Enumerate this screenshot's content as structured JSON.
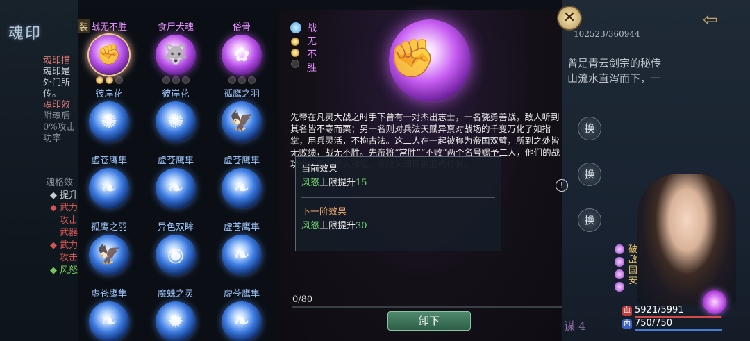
{
  "left_panel": {
    "title": "魂印",
    "lines": [
      {
        "text": "魂印描",
        "style": "head"
      },
      {
        "text": "魂印是",
        "style": "normal"
      },
      {
        "text": "外门所",
        "style": "normal"
      },
      {
        "text": "传。",
        "style": "normal"
      },
      {
        "text": "魂印效",
        "style": "head"
      },
      {
        "text": "附魂后",
        "style": "mute"
      },
      {
        "text": "0%攻击",
        "style": "mute"
      },
      {
        "text": "功率",
        "style": "mute"
      }
    ],
    "lines2": [
      {
        "text": "魂格效",
        "style": "mute"
      },
      {
        "text": "◆ 提升",
        "style": "normal"
      },
      {
        "text": "◆ 武力",
        "style": "red"
      },
      {
        "text": "攻击",
        "style": "red"
      },
      {
        "text": "武器",
        "style": "red"
      },
      {
        "text": "◆ 武力",
        "style": "red"
      },
      {
        "text": "攻击",
        "style": "red"
      },
      {
        "text": "◆ 风怒",
        "style": "green"
      }
    ]
  },
  "grid": {
    "equipped_tag": "装",
    "cells": [
      {
        "name": "战无不胜",
        "color": "purple",
        "glyph": "✊",
        "dots": [
          1,
          1,
          0
        ],
        "selected": true
      },
      {
        "name": "食尸犬魂",
        "color": "purple",
        "glyph": "🐺",
        "dots": [
          0,
          0,
          0
        ],
        "selected": false
      },
      {
        "name": "俗骨",
        "color": "purple",
        "glyph": "✿",
        "dots": [
          0,
          0,
          0
        ],
        "selected": false
      },
      {
        "name": "彼岸花",
        "color": "blue",
        "glyph": "✺",
        "dots": [],
        "selected": false
      },
      {
        "name": "彼岸花",
        "color": "blue",
        "glyph": "✺",
        "dots": [],
        "selected": false
      },
      {
        "name": "孤鹰之羽",
        "color": "blue",
        "glyph": "🦅",
        "dots": [],
        "selected": false
      },
      {
        "name": "虚苍鹰隼",
        "color": "blue",
        "glyph": "❧",
        "dots": [],
        "selected": false
      },
      {
        "name": "虚苍鹰隼",
        "color": "blue",
        "glyph": "❧",
        "dots": [],
        "selected": false
      },
      {
        "name": "虚苍鹰隼",
        "color": "blue",
        "glyph": "❧",
        "dots": [],
        "selected": false
      },
      {
        "name": "孤鹰之羽",
        "color": "blue",
        "glyph": "🦅",
        "dots": [],
        "selected": false
      },
      {
        "name": "异色双眸",
        "color": "blue",
        "glyph": "◉",
        "dots": [],
        "selected": false
      },
      {
        "name": "虚苍鹰隼",
        "color": "blue",
        "glyph": "❧",
        "dots": [],
        "selected": false
      },
      {
        "name": "虚苍鹰隼",
        "color": "blue",
        "glyph": "❧",
        "dots": [],
        "selected": false
      },
      {
        "name": "魔蛛之灵",
        "color": "blue",
        "glyph": "✹",
        "dots": [],
        "selected": false
      },
      {
        "name": "虚苍鹰隼",
        "color": "blue",
        "glyph": "❧",
        "dots": [],
        "selected": false
      }
    ]
  },
  "detail": {
    "name_chars": [
      "战",
      "无",
      "不",
      "胜"
    ],
    "rank_dots": [
      1,
      1,
      0
    ],
    "emblem_glyph": "✊",
    "description": "先帝在凡灵大战之时手下曾有一对杰出志士，一名骁勇善战，敌人听到其名皆不寒而栗；另一名则对兵法天赋异禀对战场的千变万化了如指掌，用兵灵活，不拘古法。这二人在一起被称为帝国双璧，所到之处皆无败绩，战无不胜。先帝将“常胜”“不败”两个名号赐予二人，他们的战功也一直为世人称道，令敌人闻风丧胆的传说。",
    "current_effect": {
      "title": "当前效果",
      "stat": "风怒",
      "text": "上限提升",
      "value": "15"
    },
    "next_effect": {
      "title": "下一阶效果",
      "stat": "风怒",
      "text": "上限提升",
      "value": "30"
    },
    "progress": {
      "label": "0/80",
      "fraction": 0.0
    },
    "unload_label": "卸下"
  },
  "right_panel": {
    "stamina": "102523/360944",
    "text_lines": [
      "曾是青云剑宗的秘传",
      "山流水直泻而下，一"
    ],
    "swap_label": "换",
    "alert_glyph": "!",
    "close_glyph": "✕",
    "back_glyph": "⇦",
    "character_name": "破敌国安",
    "hp": "5921/5991",
    "hp_fraction": 0.988,
    "hp_icon": "血",
    "mp": "750/750",
    "mp_fraction": 1.0,
    "mp_icon": "内",
    "level_text": "谋 4"
  },
  "colors": {
    "purple_name": "#e58cff",
    "blue_name": "#9fc8ff",
    "effect_green": "#6fd06f",
    "next_title": "#e6a66a"
  }
}
